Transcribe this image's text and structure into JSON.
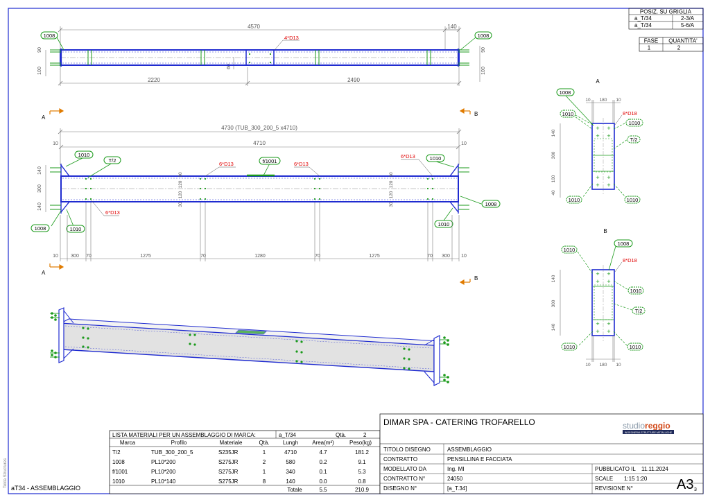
{
  "grid_table": {
    "title": "POSIZ. SU GRIGLIA",
    "rows": [
      [
        "a_T/34",
        "2-3/A"
      ],
      [
        "a_T/34",
        "5-6/A"
      ]
    ]
  },
  "phase_table": {
    "headers": [
      "FASE",
      "QUANTITA'"
    ],
    "values": [
      "1",
      "2"
    ]
  },
  "top_view": {
    "overall_dim": "4570",
    "right_dim": "140",
    "hole_label": "4*D13",
    "left_ref": "1008",
    "right_ref": "1008",
    "left_h_top": "90",
    "left_h_bot": "100",
    "right_h_top": "90",
    "right_h_bot": "100",
    "mid_small": "60",
    "seg1": "2220",
    "seg2": "2490"
  },
  "section_markers": {
    "a": "A",
    "b": "B"
  },
  "side_view": {
    "profile_dim": "4730 (TUB_300_200_5 x4710)",
    "inner_dim": "4710",
    "edge_left": "10",
    "edge_right": "10",
    "ref_1010": "1010",
    "ref_t2": "T/2",
    "ref_f1001": "f/1001",
    "ref_1008": "1008",
    "hole_6d13": "6*D13",
    "h140": "140",
    "h300": "300",
    "v30": "30",
    "v120": "120",
    "bottom_dims": [
      "10",
      "300",
      "70",
      "1275",
      "70",
      "1280",
      "70",
      "1275",
      "70",
      "300",
      "10"
    ]
  },
  "section_a": {
    "title": "A",
    "ref_1008": "1008",
    "ref_1010": "1010",
    "ref_t2": "T/2",
    "holes": "8*D18",
    "top_dims": [
      "10",
      "180",
      "10"
    ],
    "v_dims": [
      "140",
      "300",
      "100",
      "40"
    ]
  },
  "section_b": {
    "title": "B",
    "ref_1008": "1008",
    "ref_1010": "1010",
    "ref_t2": "T/2",
    "holes": "8*D18",
    "bottom_dims": [
      "10",
      "180",
      "10"
    ],
    "v_dims": [
      "140",
      "300",
      "140"
    ]
  },
  "materials": {
    "title": "LISTA MATERIALI PER UN ASSEMBLAGGIO DI MARCA:",
    "mark": "a_T/34",
    "qty_label": "Qtà.",
    "qty": "2",
    "headers": [
      "Marca",
      "Profilo",
      "Materiale",
      "Qtà.",
      "Lungh",
      "Area(m²)",
      "Peso(kg)"
    ],
    "rows": [
      [
        "T/2",
        "TUB_300_200_5",
        "S235JR",
        "1",
        "4710",
        "4.7",
        "181.2"
      ],
      [
        "1008",
        "PL10*200",
        "S275JR",
        "2",
        "580",
        "0.2",
        "9.1"
      ],
      [
        "f/1001",
        "PL10*200",
        "S275JR",
        "1",
        "340",
        "0.1",
        "5.3"
      ],
      [
        "1010",
        "PL10*140",
        "S275JR",
        "8",
        "140",
        "0.0",
        "0.8"
      ]
    ],
    "total_label": "Totale",
    "total_area": "5.5",
    "total_weight": "210.9"
  },
  "title_block": {
    "project": "DIMAR SPA - CATERING TROFARELLO",
    "logo_main": "studio",
    "logo_accent": "reggio",
    "logo_sub": "INGEGNERIA STRUTTURE METALLICHE",
    "labels": [
      "TITOLO DISEGNO",
      "CONTRATTO",
      "MODELLATO DA",
      "CONTRATTO N°",
      "DISEGNO N°"
    ],
    "values": [
      "ASSEMBLAGGIO",
      "PENSILLINA E FACCIATA",
      "Ing. MI",
      "24050",
      "[a_T.34]"
    ],
    "published_label": "PUBBLICATO IL",
    "published": "11.11.2024",
    "scale_label": "SCALE",
    "scale": "1:15  1:20",
    "revision_label": "REVISIONE N°",
    "sheet_size": "A3",
    "sheet_sub": "3"
  },
  "footer": {
    "drawing_name": "aT34 - ASSEMBLAGGIO",
    "software": "Tekla Structures"
  },
  "colors": {
    "steel": "#1f2bd0",
    "dim": "#7a7a7a",
    "bubble": "#1a9a1a",
    "accent": "#e07b00",
    "red": "#e00000"
  }
}
